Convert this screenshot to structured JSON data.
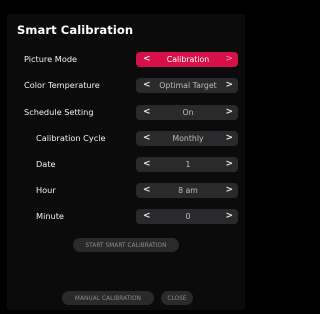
{
  "title": "Smart Calibration",
  "rows": [
    {
      "label": "Picture Mode",
      "value": "Calibration"
    },
    {
      "label": "Color Temperature",
      "value": "Optimal Target"
    },
    {
      "label": "Schedule Setting",
      "value": "On"
    },
    {
      "label": "Calibration Cycle",
      "value": "Monthly"
    },
    {
      "label": "Date",
      "value": "1"
    },
    {
      "label": "Hour",
      "value": "8 am"
    },
    {
      "label": "Minute",
      "value": "0"
    }
  ],
  "arrows": {
    "left": "<",
    "right": ">"
  },
  "buttons": {
    "start": "START SMART CALIBRATION",
    "manual": "MANUAL CALIBRATION",
    "close": "CLOSE"
  },
  "colors": {
    "background": "#000000",
    "active_selector": "#d6104a",
    "selector": "#2a2a2c"
  }
}
